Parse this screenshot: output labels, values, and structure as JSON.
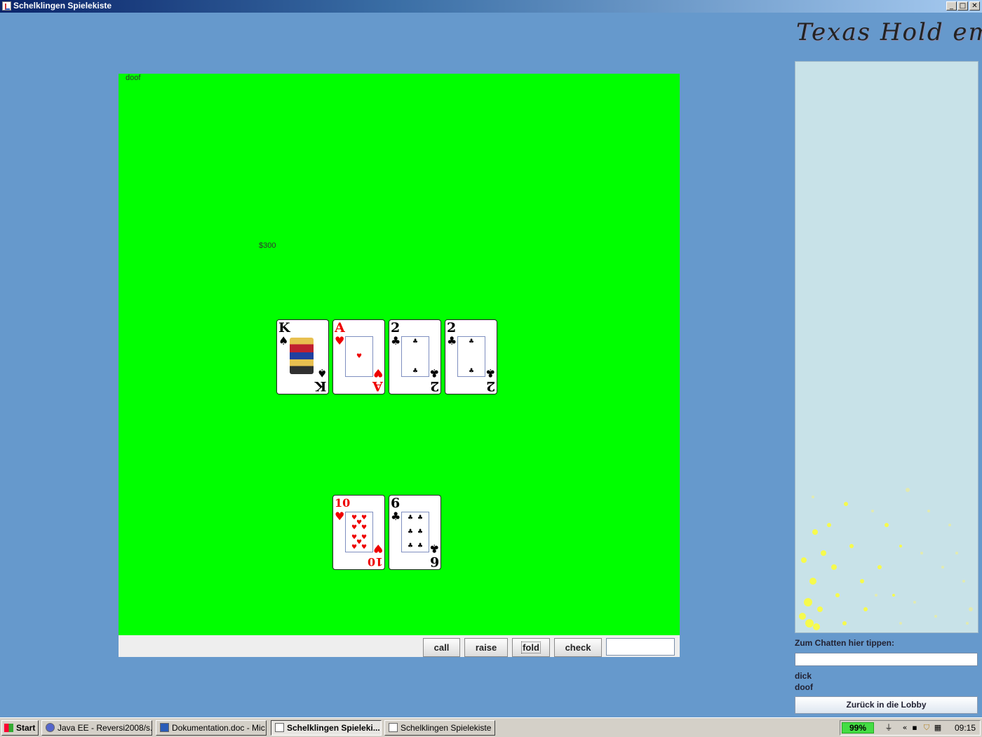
{
  "window": {
    "title": "Schelklingen Spielekiste",
    "minimize": "_",
    "maximize": "□",
    "close": "✕"
  },
  "logo": {
    "text": "Texas Hold em"
  },
  "table": {
    "player_name": "doof",
    "pot": "$300",
    "background_color": "#00ff00",
    "community_cards": [
      {
        "rank": "K",
        "suit": "♠",
        "color": "black"
      },
      {
        "rank": "A",
        "suit": "♥",
        "color": "red"
      },
      {
        "rank": "2",
        "suit": "♣",
        "color": "black"
      },
      {
        "rank": "2",
        "suit": "♣",
        "color": "black"
      }
    ],
    "hand_cards": [
      {
        "rank": "10",
        "suit": "♥",
        "color": "red"
      },
      {
        "rank": "6",
        "suit": "♣",
        "color": "black"
      }
    ]
  },
  "actions": {
    "call": "call",
    "raise": "raise",
    "fold": "fold",
    "check": "check",
    "amount_value": ""
  },
  "chat": {
    "label": "Zum Chatten hier tippen:",
    "input_value": "",
    "users": [
      "dick",
      "doof"
    ],
    "lobby_button": "Zurück in die Lobby"
  },
  "taskbar": {
    "start": "Start",
    "tasks": [
      {
        "label": "Java EE - Reversi2008/s...",
        "icon": "eclipse-icon",
        "active": false
      },
      {
        "label": "Dokumentation.doc - Mic...",
        "icon": "word-icon",
        "active": false
      },
      {
        "label": "Schelklingen Spieleki...",
        "icon": "java-icon",
        "active": true
      },
      {
        "label": "Schelklingen Spielekiste",
        "icon": "java-icon",
        "active": false
      }
    ],
    "battery": "99%",
    "tray_chevron": "«",
    "clock": "09:15"
  }
}
